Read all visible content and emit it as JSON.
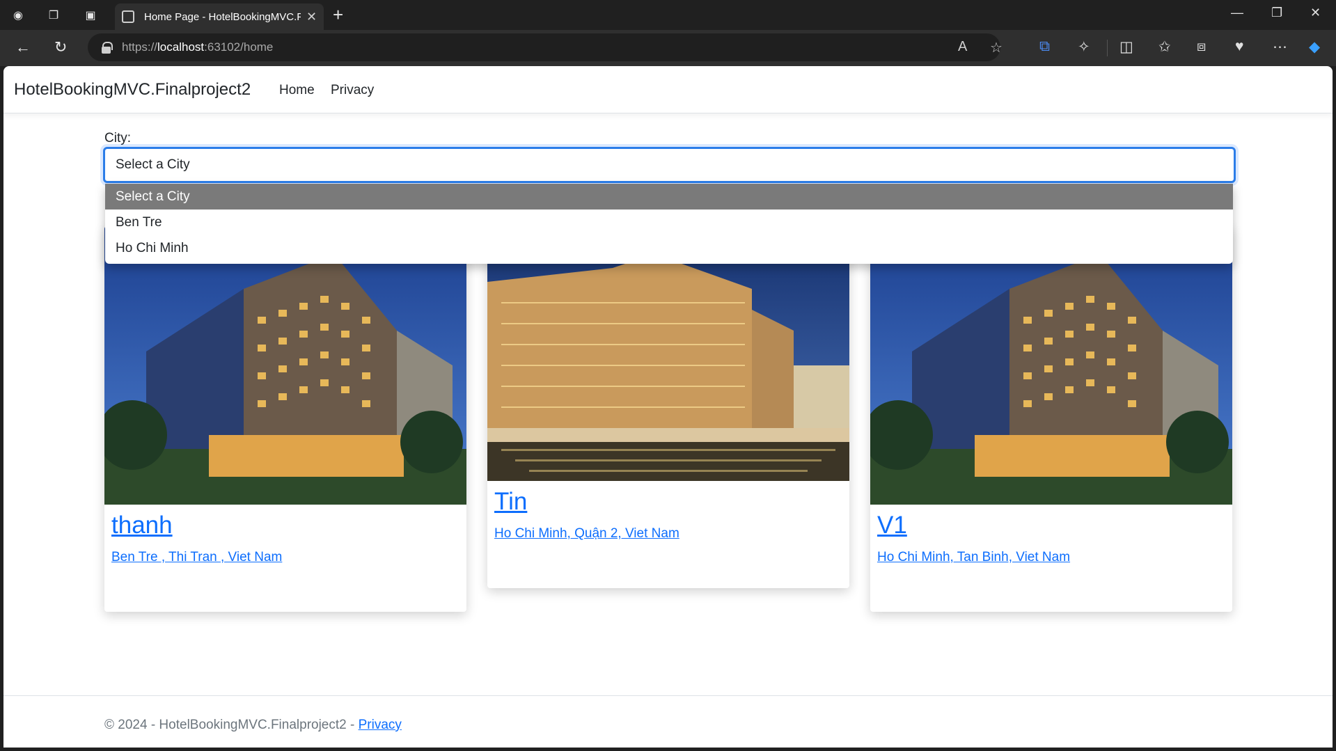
{
  "browser": {
    "tab_title": "Home Page - HotelBookingMVC.F",
    "url_prefix": "https://",
    "url_host": "localhost",
    "url_rest": ":63102/home"
  },
  "navbar": {
    "brand": "HotelBookingMVC.Finalproject2",
    "links": [
      "Home",
      "Privacy"
    ]
  },
  "filter": {
    "label": "City:",
    "selected": "Select a City",
    "options": [
      "Select a City",
      "Ben Tre",
      "Ho Chi Minh"
    ]
  },
  "hotels": [
    {
      "name": "thanh",
      "address": "Ben Tre , Thi Tran , Viet Nam"
    },
    {
      "name": "Tin",
      "address": "Ho Chi Minh, Quận 2, Viet Nam"
    },
    {
      "name": "V1",
      "address": "Ho Chi Minh, Tan Binh, Viet Nam"
    }
  ],
  "footer": {
    "text": "© 2024 - HotelBookingMVC.Finalproject2 - ",
    "link": "Privacy"
  },
  "colors": {
    "link": "#0d6efd",
    "focus_border": "#2b7de9",
    "option_selected_bg": "#7a7a7a"
  }
}
